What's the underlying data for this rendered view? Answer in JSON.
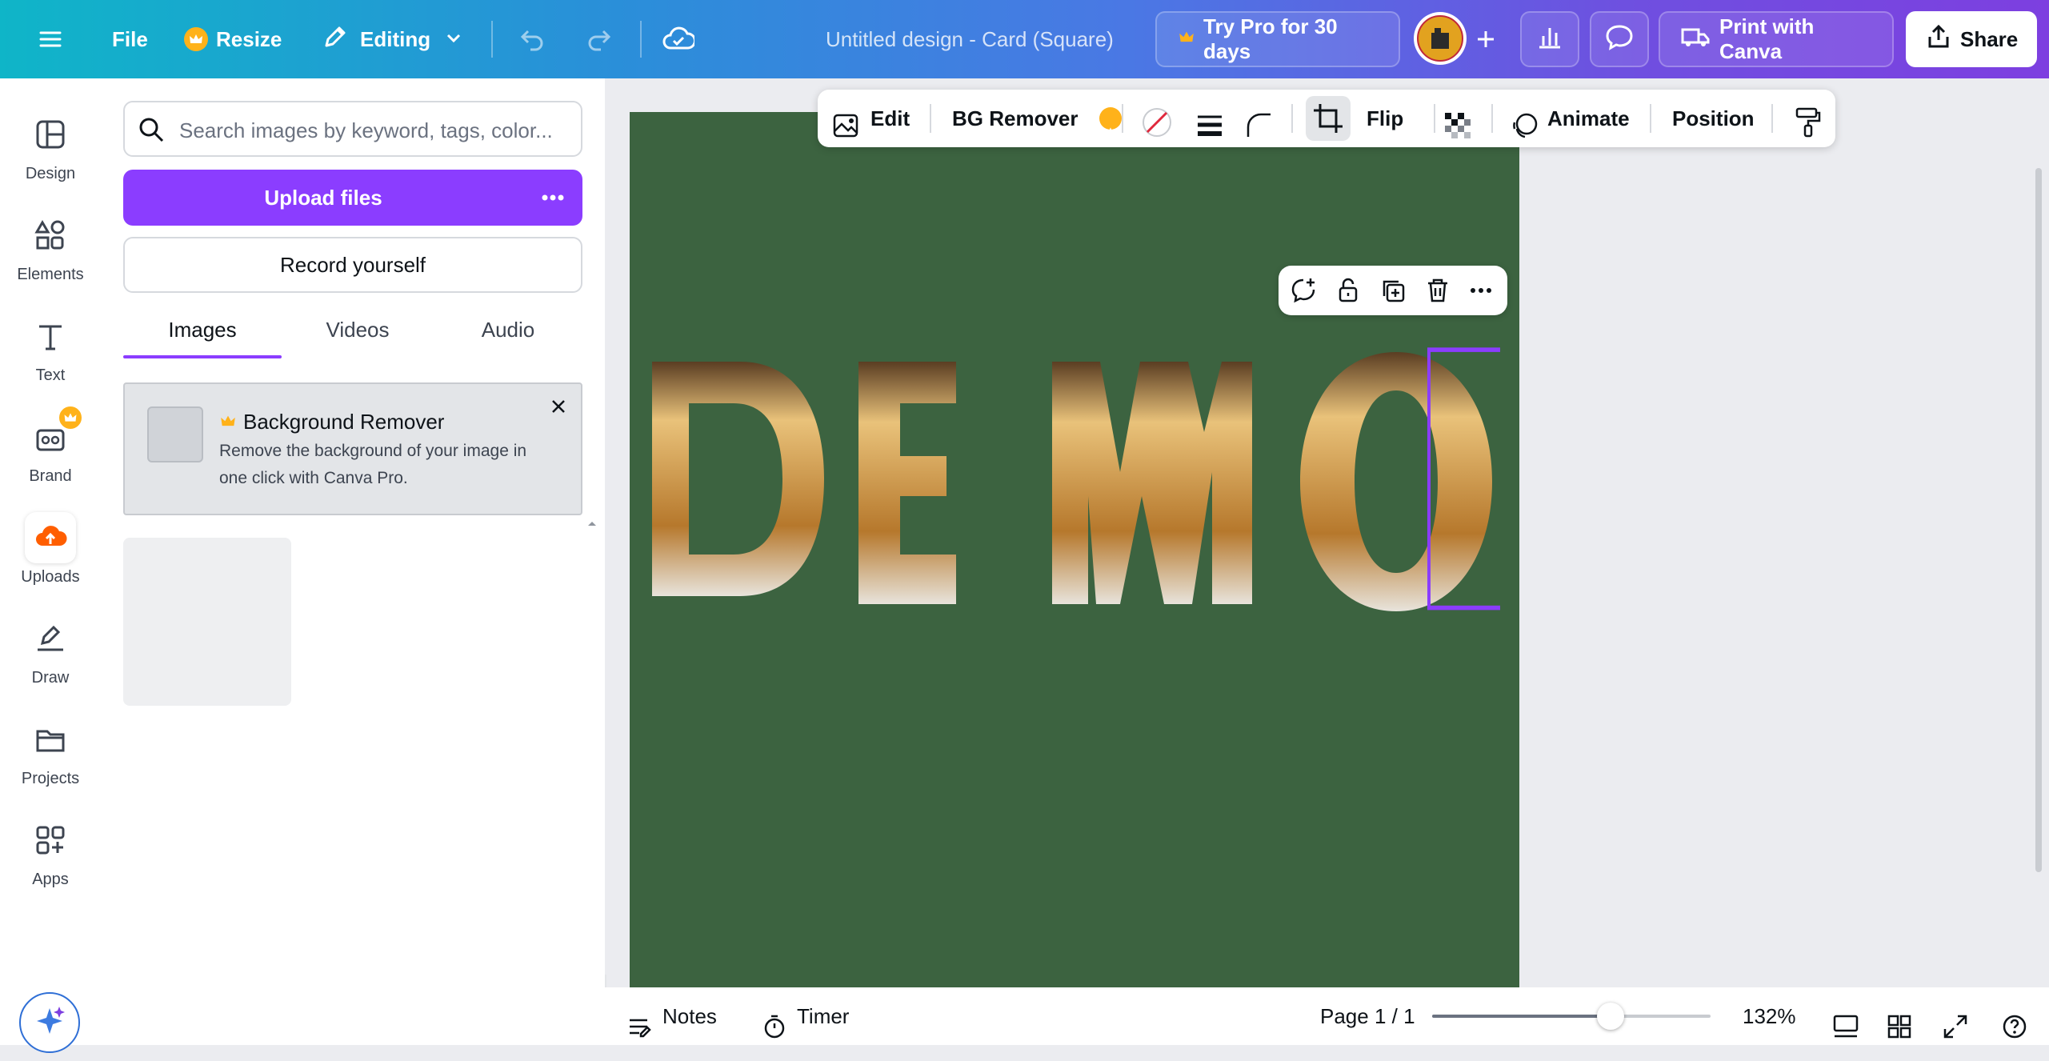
{
  "topbar": {
    "menu_icon": "hamburger-icon",
    "file_label": "File",
    "resize_label": "Resize",
    "editing_label": "Editing",
    "doc_title": "Untitled design - Card (Square)",
    "try_pro_label": "Try Pro for 30 days",
    "print_label": "Print with Canva",
    "share_label": "Share"
  },
  "nav": {
    "items": [
      {
        "label": "Design",
        "icon": "layout-icon"
      },
      {
        "label": "Elements",
        "icon": "shapes-icon"
      },
      {
        "label": "Text",
        "icon": "text-icon"
      },
      {
        "label": "Brand",
        "icon": "brand-icon"
      },
      {
        "label": "Uploads",
        "icon": "cloud-upload-icon"
      },
      {
        "label": "Draw",
        "icon": "pen-icon"
      },
      {
        "label": "Projects",
        "icon": "folder-icon"
      },
      {
        "label": "Apps",
        "icon": "apps-icon"
      }
    ]
  },
  "panel": {
    "search_placeholder": "Search images by keyword, tags, color...",
    "upload_label": "Upload files",
    "record_label": "Record yourself",
    "tabs": [
      "Images",
      "Videos",
      "Audio"
    ],
    "promo_title": "Background Remover",
    "promo_text_1": "Remove the background of your image in",
    "promo_text_2": "one click with Canva Pro."
  },
  "toolbar": {
    "edit_label": "Edit",
    "bg_remover_label": "BG Remover",
    "flip_label": "Flip",
    "animate_label": "Animate",
    "position_label": "Position"
  },
  "canvas": {
    "background_color": "#3c6340",
    "letters": [
      "D",
      "E",
      "M",
      "O"
    ],
    "selected_letter": "O"
  },
  "bottombar": {
    "notes_label": "Notes",
    "timer_label": "Timer",
    "page_label": "Page 1 / 1",
    "zoom_label": "132%",
    "zoom_fraction": 0.64
  },
  "colors": {
    "accent": "#8b3dff",
    "selection": "#8b3dff",
    "crown": "#ffb21a"
  }
}
